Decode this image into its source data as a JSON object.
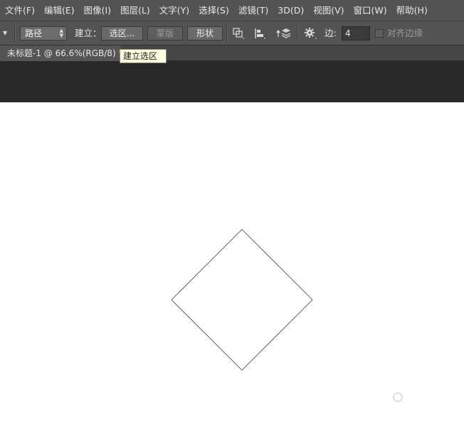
{
  "menu": {
    "items": [
      "文件(F)",
      "编辑(E)",
      "图像(I)",
      "图层(L)",
      "文字(Y)",
      "选择(S)",
      "滤镜(T)",
      "3D(D)",
      "视图(V)",
      "窗口(W)",
      "帮助(H)"
    ]
  },
  "options": {
    "tool_mode_value": "路径",
    "make_label": "建立：",
    "selection_button": "选区...",
    "mask_button": "蒙版",
    "shape_button": "形状",
    "edge_label": "边:",
    "edge_value": "4",
    "align_edges_label": "对齐边缘",
    "icons": [
      "tool-preset-icon",
      "path-operations-icon",
      "path-alignment-icon",
      "path-arrangement-icon",
      "gear-icon"
    ]
  },
  "document": {
    "tab_title": "未标题-1 @ 66.6%(RGB/8) *",
    "tooltip": "建立选区"
  },
  "colors": {
    "panel": "#535353",
    "pasteboard": "#282828",
    "canvas": "#ffffff",
    "tooltip_bg": "#ffffe1"
  }
}
